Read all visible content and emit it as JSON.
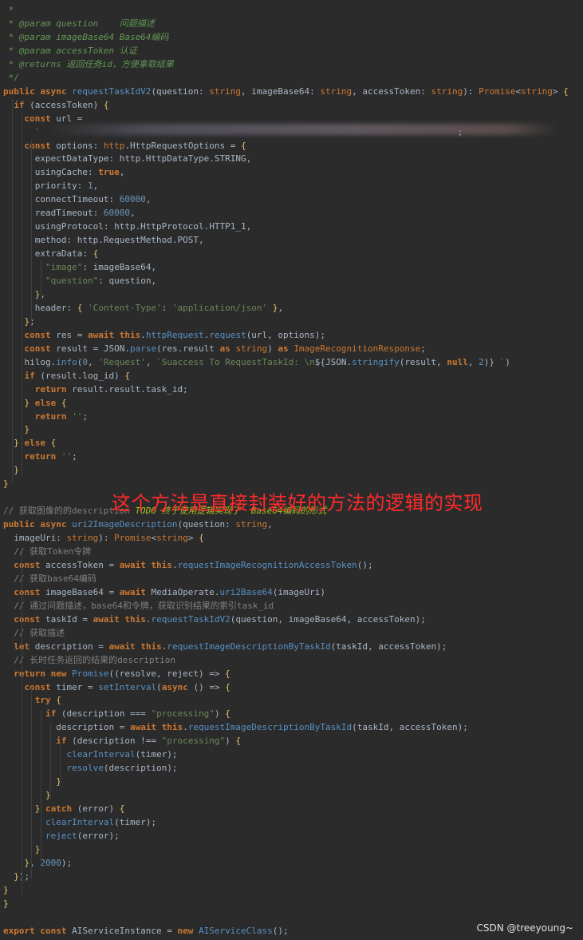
{
  "annotation": "这个方法是直接封装好的方法的逻辑的实现",
  "watermark": "CSDN @treeyoung~",
  "lines": [
    [
      [
        "t-doc",
        " *"
      ]
    ],
    [
      [
        "t-doc",
        " * @param question    问题描述"
      ]
    ],
    [
      [
        "t-doc",
        " * @param imageBase64 Base64编码"
      ]
    ],
    [
      [
        "t-doc",
        " * @param accessToken 认证"
      ]
    ],
    [
      [
        "t-doc",
        " * @returns 返回任务id，方便拿取结果"
      ]
    ],
    [
      [
        "t-doc",
        " */"
      ]
    ],
    [
      [
        "t-kw",
        "public async "
      ],
      [
        "t-fn",
        "requestTaskIdV2"
      ],
      [
        "t-punc",
        "(question: "
      ],
      [
        "t-type",
        "string"
      ],
      [
        "t-punc",
        ", imageBase64: "
      ],
      [
        "t-type",
        "string"
      ],
      [
        "t-punc",
        ", accessToken: "
      ],
      [
        "t-type",
        "string"
      ],
      [
        "t-punc",
        "): "
      ],
      [
        "t-type",
        "Promise"
      ],
      [
        "t-punc",
        "<"
      ],
      [
        "t-type",
        "string"
      ],
      [
        "t-punc",
        "> "
      ],
      [
        "t-brace",
        "{"
      ]
    ],
    [
      [
        "t-kw",
        "  if "
      ],
      [
        "t-punc",
        "(accessToken) "
      ],
      [
        "t-brace",
        "{"
      ]
    ],
    [
      [
        "t-kw",
        "    const "
      ],
      [
        "t-punc",
        "url ="
      ]
    ],
    [
      [
        "t-str",
        "      `"
      ],
      [
        "t-punc",
        "                                                                               "
      ],
      [
        "t-punc",
        ";"
      ]
    ],
    [
      [
        "t-kw",
        "    const "
      ],
      [
        "t-punc",
        "options: "
      ],
      [
        "t-type",
        "http"
      ],
      [
        "t-punc",
        "."
      ],
      [
        "t-cls",
        "HttpRequestOptions"
      ],
      [
        "t-punc",
        " = "
      ],
      [
        "t-brace",
        "{"
      ]
    ],
    [
      [
        "t-punc",
        "      expectDataType: http.HttpDataType.STRING,"
      ]
    ],
    [
      [
        "t-punc",
        "      usingCache: "
      ],
      [
        "t-kw",
        "true"
      ],
      [
        "t-punc",
        ","
      ]
    ],
    [
      [
        "t-punc",
        "      priority: "
      ],
      [
        "t-num",
        "1"
      ],
      [
        "t-punc",
        ","
      ]
    ],
    [
      [
        "t-punc",
        "      connectTimeout: "
      ],
      [
        "t-num",
        "60000"
      ],
      [
        "t-punc",
        ","
      ]
    ],
    [
      [
        "t-punc",
        "      readTimeout: "
      ],
      [
        "t-num",
        "60000"
      ],
      [
        "t-punc",
        ","
      ]
    ],
    [
      [
        "t-punc",
        "      usingProtocol: http.HttpProtocol.HTTP1_1,"
      ]
    ],
    [
      [
        "t-punc",
        "      method: http.RequestMethod.POST,"
      ]
    ],
    [
      [
        "t-punc",
        "      extraData: "
      ],
      [
        "t-brace",
        "{"
      ]
    ],
    [
      [
        "t-str",
        "        \"image\""
      ],
      [
        "t-punc",
        ": imageBase64,"
      ]
    ],
    [
      [
        "t-str",
        "        \"question\""
      ],
      [
        "t-punc",
        ": question,"
      ]
    ],
    [
      [
        "t-brace",
        "      }"
      ],
      [
        "t-punc",
        ","
      ]
    ],
    [
      [
        "t-punc",
        "      header: "
      ],
      [
        "t-brace",
        "{ "
      ],
      [
        "t-str",
        "'Content-Type'"
      ],
      [
        "t-punc",
        ": "
      ],
      [
        "t-str",
        "'application/json'"
      ],
      [
        "t-brace",
        " }"
      ],
      [
        "t-punc",
        ","
      ]
    ],
    [
      [
        "t-brace",
        "    }"
      ],
      [
        "t-punc",
        ";"
      ]
    ],
    [
      [
        "t-kw",
        "    const "
      ],
      [
        "t-punc",
        "res = "
      ],
      [
        "t-kw",
        "await this"
      ],
      [
        "t-punc",
        "."
      ],
      [
        "t-fn",
        "httpRequest"
      ],
      [
        "t-punc",
        "."
      ],
      [
        "t-fn",
        "request"
      ],
      [
        "t-punc",
        "(url, options);"
      ]
    ],
    [
      [
        "t-kw",
        "    const "
      ],
      [
        "t-punc",
        "result = JSON."
      ],
      [
        "t-fn",
        "parse"
      ],
      [
        "t-punc",
        "(res.result "
      ],
      [
        "t-kw",
        "as "
      ],
      [
        "t-type",
        "string"
      ],
      [
        "t-punc",
        ") "
      ],
      [
        "t-kw",
        "as "
      ],
      [
        "t-type",
        "ImageRecognitionResponse"
      ],
      [
        "t-punc",
        ";"
      ]
    ],
    [
      [
        "t-punc",
        "    hilog."
      ],
      [
        "t-fn",
        "info"
      ],
      [
        "t-punc",
        "("
      ],
      [
        "t-num",
        "0"
      ],
      [
        "t-punc",
        ", "
      ],
      [
        "t-str",
        "'Request'"
      ],
      [
        "t-punc",
        ", "
      ],
      [
        "t-str",
        "`Suaccess To RequestTaskId: \\n"
      ],
      [
        "t-punc",
        "${JSON."
      ],
      [
        "t-fn",
        "stringify"
      ],
      [
        "t-punc",
        "(result, "
      ],
      [
        "t-kw",
        "null"
      ],
      [
        "t-punc",
        ", "
      ],
      [
        "t-num",
        "2"
      ],
      [
        "t-punc",
        ")}"
      ],
      [
        "t-str",
        " `"
      ],
      [
        "t-punc",
        ")"
      ]
    ],
    [
      [
        "t-kw",
        "    if "
      ],
      [
        "t-punc",
        "(result.log_id) "
      ],
      [
        "t-brace",
        "{"
      ]
    ],
    [
      [
        "t-kw",
        "      return "
      ],
      [
        "t-punc",
        "result.result.task_id;"
      ]
    ],
    [
      [
        "t-brace",
        "    } "
      ],
      [
        "t-kw",
        "else "
      ],
      [
        "t-brace",
        "{"
      ]
    ],
    [
      [
        "t-kw",
        "      return "
      ],
      [
        "t-str",
        "''"
      ],
      [
        "t-punc",
        ";"
      ]
    ],
    [
      [
        "t-brace",
        "    }"
      ]
    ],
    [
      [
        "t-brace",
        "  } "
      ],
      [
        "t-kw",
        "else "
      ],
      [
        "t-brace",
        "{"
      ]
    ],
    [
      [
        "t-kw",
        "    return "
      ],
      [
        "t-str",
        "''"
      ],
      [
        "t-punc",
        ";"
      ]
    ],
    [
      [
        "t-brace",
        "  }"
      ]
    ],
    [
      [
        "t-brace",
        "}"
      ]
    ],
    [
      [
        "t-punc",
        " "
      ]
    ],
    [
      [
        "t-com",
        "// 获取图像的的description "
      ],
      [
        "t-todo",
        "TODO 终于使用逻辑实现了  Base64编码的形式"
      ]
    ],
    [
      [
        "t-kw",
        "public async "
      ],
      [
        "t-fn",
        "uri2ImageDescription"
      ],
      [
        "t-punc",
        "(question: "
      ],
      [
        "t-type",
        "string"
      ],
      [
        "t-punc",
        ","
      ]
    ],
    [
      [
        "t-punc",
        "  imageUri: "
      ],
      [
        "t-type",
        "string"
      ],
      [
        "t-punc",
        "): "
      ],
      [
        "t-type",
        "Promise"
      ],
      [
        "t-punc",
        "<"
      ],
      [
        "t-type",
        "string"
      ],
      [
        "t-punc",
        "> "
      ],
      [
        "t-brace",
        "{"
      ]
    ],
    [
      [
        "t-com",
        "  // 获取Token令牌"
      ]
    ],
    [
      [
        "t-kw",
        "  const "
      ],
      [
        "t-punc",
        "accessToken = "
      ],
      [
        "t-kw",
        "await this"
      ],
      [
        "t-punc",
        "."
      ],
      [
        "t-fn",
        "requestImageRecognitionAccessToken"
      ],
      [
        "t-punc",
        "();"
      ]
    ],
    [
      [
        "t-com",
        "  // 获取base64编码"
      ]
    ],
    [
      [
        "t-kw",
        "  const "
      ],
      [
        "t-punc",
        "imageBase64 = "
      ],
      [
        "t-kw",
        "await "
      ],
      [
        "t-punc",
        "MediaOperate."
      ],
      [
        "t-fn",
        "uri2Base64"
      ],
      [
        "t-punc",
        "(imageUri)"
      ]
    ],
    [
      [
        "t-com",
        "  // 通过问题描述，base64和令牌，获取识别结果的索引task_id"
      ]
    ],
    [
      [
        "t-kw",
        "  const "
      ],
      [
        "t-punc",
        "taskId = "
      ],
      [
        "t-kw",
        "await this"
      ],
      [
        "t-punc",
        "."
      ],
      [
        "t-fn",
        "requestTaskIdV2"
      ],
      [
        "t-punc",
        "(question, imageBase64, accessToken);"
      ]
    ],
    [
      [
        "t-com",
        "  // 获取描述"
      ]
    ],
    [
      [
        "t-kw",
        "  let "
      ],
      [
        "t-punc",
        "description = "
      ],
      [
        "t-kw",
        "await this"
      ],
      [
        "t-punc",
        "."
      ],
      [
        "t-fn",
        "requestImageDescriptionByTaskId"
      ],
      [
        "t-punc",
        "(taskId, accessToken);"
      ]
    ],
    [
      [
        "t-com",
        "  // 长时任务返回的结果的description"
      ]
    ],
    [
      [
        "t-kw",
        "  return new "
      ],
      [
        "t-fn",
        "Promise"
      ],
      [
        "t-punc",
        "((resolve, reject) => "
      ],
      [
        "t-brace",
        "{"
      ]
    ],
    [
      [
        "t-kw",
        "    const "
      ],
      [
        "t-punc",
        "timer = "
      ],
      [
        "t-fn",
        "setInterval"
      ],
      [
        "t-punc",
        "("
      ],
      [
        "t-kw",
        "async "
      ],
      [
        "t-punc",
        "() => "
      ],
      [
        "t-brace",
        "{"
      ]
    ],
    [
      [
        "t-kw",
        "      try "
      ],
      [
        "t-brace",
        "{"
      ]
    ],
    [
      [
        "t-kw",
        "        if "
      ],
      [
        "t-punc",
        "(description === "
      ],
      [
        "t-str",
        "\"processing\""
      ],
      [
        "t-punc",
        ") "
      ],
      [
        "t-brace",
        "{"
      ]
    ],
    [
      [
        "t-punc",
        "          description = "
      ],
      [
        "t-kw",
        "await this"
      ],
      [
        "t-punc",
        "."
      ],
      [
        "t-fn",
        "requestImageDescriptionByTaskId"
      ],
      [
        "t-punc",
        "(taskId, accessToken);"
      ]
    ],
    [
      [
        "t-kw",
        "          if "
      ],
      [
        "t-punc",
        "(description !== "
      ],
      [
        "t-str",
        "\"processing\""
      ],
      [
        "t-punc",
        ") "
      ],
      [
        "t-brace",
        "{"
      ]
    ],
    [
      [
        "t-fn",
        "            clearInterval"
      ],
      [
        "t-punc",
        "(timer);"
      ]
    ],
    [
      [
        "t-fn",
        "            resolve"
      ],
      [
        "t-punc",
        "(description);"
      ]
    ],
    [
      [
        "t-brace",
        "          }"
      ]
    ],
    [
      [
        "t-brace",
        "        }"
      ]
    ],
    [
      [
        "t-brace",
        "      } "
      ],
      [
        "t-kw",
        "catch "
      ],
      [
        "t-punc",
        "(error) "
      ],
      [
        "t-brace",
        "{"
      ]
    ],
    [
      [
        "t-fn",
        "        clearInterval"
      ],
      [
        "t-punc",
        "(timer);"
      ]
    ],
    [
      [
        "t-fn",
        "        reject"
      ],
      [
        "t-punc",
        "(error);"
      ]
    ],
    [
      [
        "t-brace",
        "      }"
      ]
    ],
    [
      [
        "t-brace",
        "    }"
      ],
      [
        "t-punc",
        ", "
      ],
      [
        "t-num",
        "2000"
      ],
      [
        "t-punc",
        ");"
      ]
    ],
    [
      [
        "t-brace",
        "  }"
      ],
      [
        "t-punc",
        ");"
      ]
    ],
    [
      [
        "t-brace",
        "}"
      ]
    ],
    [
      [
        "t-brace",
        "}"
      ]
    ],
    [
      [
        "t-punc",
        " "
      ]
    ],
    [
      [
        "t-kw",
        "export const "
      ],
      [
        "t-punc",
        "AIServiceInstance = "
      ],
      [
        "t-kw",
        "new "
      ],
      [
        "t-fn",
        "AIServiceClass"
      ],
      [
        "t-punc",
        "();"
      ]
    ]
  ]
}
